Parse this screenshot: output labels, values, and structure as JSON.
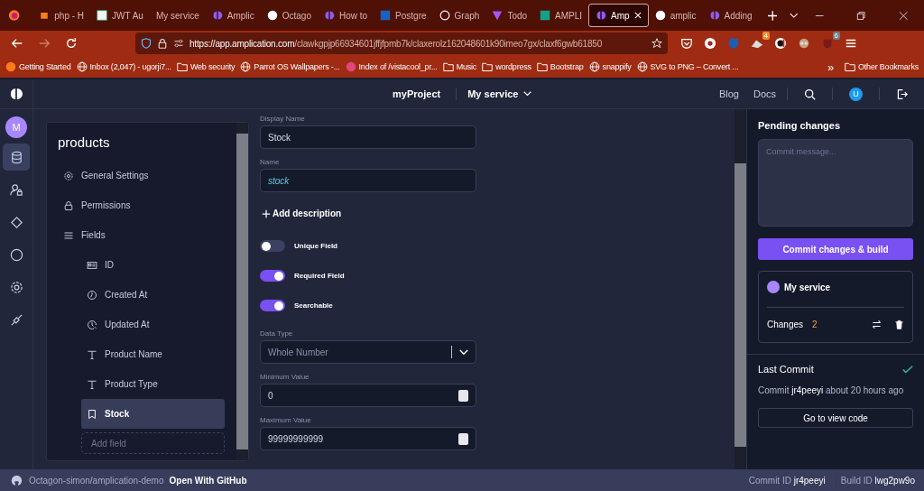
{
  "browser": {
    "tabs": [
      {
        "label": "php - H",
        "selected": false
      },
      {
        "label": "JWT Au",
        "selected": false
      },
      {
        "label": "My service",
        "selected": false
      },
      {
        "label": "Amplic",
        "selected": false
      },
      {
        "label": "Octago",
        "selected": false
      },
      {
        "label": "How to",
        "selected": false
      },
      {
        "label": "Postgre",
        "selected": false
      },
      {
        "label": "Graph",
        "selected": false
      },
      {
        "label": "Todo",
        "selected": false
      },
      {
        "label": "AMPLI",
        "selected": false
      },
      {
        "label": "Amp",
        "selected": true
      },
      {
        "label": "amplic",
        "selected": false
      },
      {
        "label": "Adding",
        "selected": false
      }
    ],
    "url_host": "https://app.amplication.com",
    "url_path": "/clawkgpjp66934601jffjfpmb7k/claxerolz162048601k90imeo7gx/claxf6gwb61850",
    "extension_badges": [
      "4",
      "6"
    ],
    "bookmarks": [
      {
        "label": "Getting Started",
        "kind": "site"
      },
      {
        "label": "Inbox (2,047) - ugorji7...",
        "kind": "globe"
      },
      {
        "label": "Web security",
        "kind": "folder"
      },
      {
        "label": "Parrot OS Wallpapers -...",
        "kind": "globe"
      },
      {
        "label": "Index of /vistacool_pr...",
        "kind": "site"
      },
      {
        "label": "Music",
        "kind": "folder"
      },
      {
        "label": "wordpress",
        "kind": "folder"
      },
      {
        "label": "Bootstrap",
        "kind": "folder"
      },
      {
        "label": "snappify",
        "kind": "globe"
      },
      {
        "label": "SVG to PNG – Convert ...",
        "kind": "globe"
      }
    ],
    "more_bookmarks": "»",
    "other_bookmarks": "Other Bookmarks"
  },
  "header": {
    "project": "myProject",
    "service": "My service",
    "links": [
      "Blog",
      "Docs"
    ],
    "user_initial": "U"
  },
  "rail": {
    "workspace_initial": "M",
    "items": [
      {
        "selected": true
      },
      {
        "selected": false
      },
      {
        "selected": false
      },
      {
        "selected": false
      },
      {
        "selected": false
      },
      {
        "selected": false
      }
    ]
  },
  "entity": {
    "title": "products",
    "nav": [
      {
        "label": "General Settings",
        "kind": "settings"
      },
      {
        "label": "Permissions",
        "kind": "lock"
      },
      {
        "label": "Fields",
        "kind": "list"
      }
    ],
    "fields": [
      {
        "label": "ID",
        "kind": "id",
        "selected": false
      },
      {
        "label": "Created At",
        "kind": "created",
        "selected": false
      },
      {
        "label": "Updated At",
        "kind": "updated",
        "selected": false
      },
      {
        "label": "Product Name",
        "kind": "text",
        "selected": false
      },
      {
        "label": "Product Type",
        "kind": "text",
        "selected": false
      },
      {
        "label": "Stock",
        "kind": "number",
        "selected": true
      }
    ],
    "add_field_placeholder": "Add field"
  },
  "form": {
    "display_name": {
      "label": "Display Name",
      "value": "Stock"
    },
    "name": {
      "label": "Name",
      "value": "stock"
    },
    "add_description": "Add description",
    "toggles": [
      {
        "label": "Unique Field",
        "on": false
      },
      {
        "label": "Required Field",
        "on": true
      },
      {
        "label": "Searchable",
        "on": true
      }
    ],
    "data_type": {
      "label": "Data Type",
      "value": "Whole Number"
    },
    "minimum": {
      "label": "Minimum Value",
      "value": "0"
    },
    "maximum": {
      "label": "Maximum Value",
      "value": "99999999999"
    }
  },
  "pending": {
    "title": "Pending changes",
    "commit_placeholder": "Commit message...",
    "commit_button": "Commit changes & build",
    "service": "My service",
    "changes_label": "Changes",
    "changes_count": "2"
  },
  "last_commit": {
    "title": "Last Commit",
    "succeeded": true,
    "text": "Commit **jr4peeyi** about 20 hours ago",
    "button": "Go to view code"
  },
  "status_bar": {
    "repo": "Octagon-simon/amplication-demo",
    "open_github": "Open With GitHub",
    "commit_label": "Commit ID",
    "commit_id": "jr4peeyi",
    "build_label": "Build ID",
    "build_id": "lwg2pw9o"
  }
}
